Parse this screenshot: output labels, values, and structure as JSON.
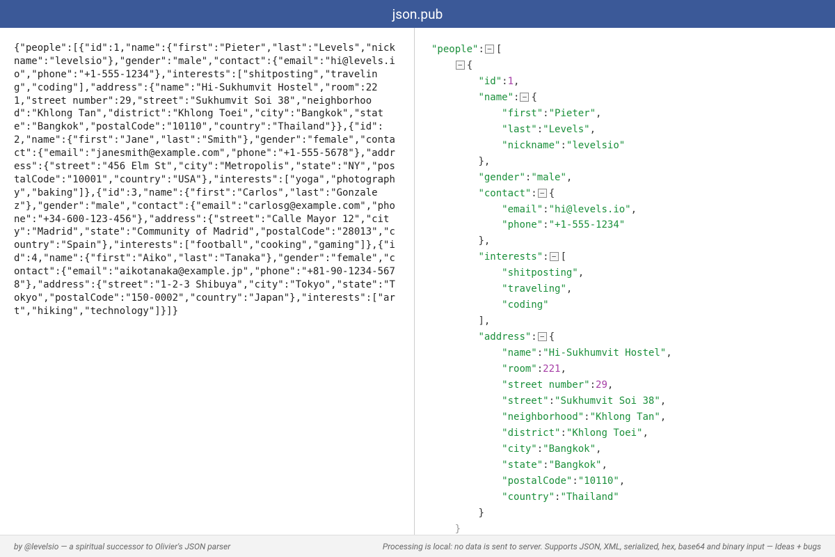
{
  "header": {
    "title": "json.pub"
  },
  "raw_input": "{\"people\":[{\"id\":1,\"name\":{\"first\":\"Pieter\",\"last\":\"Levels\",\"nickname\":\"levelsio\"},\"gender\":\"male\",\"contact\":{\"email\":\"hi@levels.io\",\"phone\":\"+1-555-1234\"},\"interests\":[\"shitposting\",\"traveling\",\"coding\"],\"address\":{\"name\":\"Hi-Sukhumvit Hostel\",\"room\":221,\"street number\":29,\"street\":\"Sukhumvit Soi 38\",\"neighborhood\":\"Khlong Tan\",\"district\":\"Khlong Toei\",\"city\":\"Bangkok\",\"state\":\"Bangkok\",\"postalCode\":\"10110\",\"country\":\"Thailand\"}},{\"id\":2,\"name\":{\"first\":\"Jane\",\"last\":\"Smith\"},\"gender\":\"female\",\"contact\":{\"email\":\"janesmith@example.com\",\"phone\":\"+1-555-5678\"},\"address\":{\"street\":\"456 Elm St\",\"city\":\"Metropolis\",\"state\":\"NY\",\"postalCode\":\"10001\",\"country\":\"USA\"},\"interests\":[\"yoga\",\"photography\",\"baking\"]},{\"id\":3,\"name\":{\"first\":\"Carlos\",\"last\":\"Gonzalez\"},\"gender\":\"male\",\"contact\":{\"email\":\"carlosg@example.com\",\"phone\":\"+34-600-123-456\"},\"address\":{\"street\":\"Calle Mayor 12\",\"city\":\"Madrid\",\"state\":\"Community of Madrid\",\"postalCode\":\"28013\",\"country\":\"Spain\"},\"interests\":[\"football\",\"cooking\",\"gaming\"]},{\"id\":4,\"name\":{\"first\":\"Aiko\",\"last\":\"Tanaka\"},\"gender\":\"female\",\"contact\":{\"email\":\"aikotanaka@example.jp\",\"phone\":\"+81-90-1234-5678\"},\"address\":{\"street\":\"1-2-3 Shibuya\",\"city\":\"Tokyo\",\"state\":\"Tokyo\",\"postalCode\":\"150-0002\",\"country\":\"Japan\"},\"interests\":[\"art\",\"hiking\",\"technology\"]}]}",
  "tree": {
    "people_key": "\"people\"",
    "person0": {
      "id_key": "\"id\"",
      "id_val": "1",
      "name_key": "\"name\"",
      "first_key": "\"first\"",
      "first_val": "\"Pieter\"",
      "last_key": "\"last\"",
      "last_val": "\"Levels\"",
      "nickname_key": "\"nickname\"",
      "nickname_val": "\"levelsio\"",
      "gender_key": "\"gender\"",
      "gender_val": "\"male\"",
      "contact_key": "\"contact\"",
      "email_key": "\"email\"",
      "email_val": "\"hi@levels.io\"",
      "phone_key": "\"phone\"",
      "phone_val": "\"+1-555-1234\"",
      "interests_key": "\"interests\"",
      "interest0": "\"shitposting\"",
      "interest1": "\"traveling\"",
      "interest2": "\"coding\"",
      "address_key": "\"address\"",
      "addr_name_key": "\"name\"",
      "addr_name_val": "\"Hi-Sukhumvit Hostel\"",
      "room_key": "\"room\"",
      "room_val": "221",
      "streetnum_key": "\"street number\"",
      "streetnum_val": "29",
      "street_key": "\"street\"",
      "street_val": "\"Sukhumvit Soi 38\"",
      "neighborhood_key": "\"neighborhood\"",
      "neighborhood_val": "\"Khlong Tan\"",
      "district_key": "\"district\"",
      "district_val": "\"Khlong Toei\"",
      "city_key": "\"city\"",
      "city_val": "\"Bangkok\"",
      "state_key": "\"state\"",
      "state_val": "\"Bangkok\"",
      "postal_key": "\"postalCode\"",
      "postal_val": "\"10110\"",
      "country_key": "\"country\"",
      "country_val": "\"Thailand\""
    }
  },
  "footer": {
    "left_prefix": "by ",
    "left_author": "@levelsio",
    "left_mid": " — a spiritual successor to ",
    "left_link": "Olivier's JSON parser",
    "right_text": "Processing is local: no data is sent to server. Supports JSON, XML, serialized, hex, base64 and binary input — ",
    "right_link": "Ideas + bugs"
  }
}
